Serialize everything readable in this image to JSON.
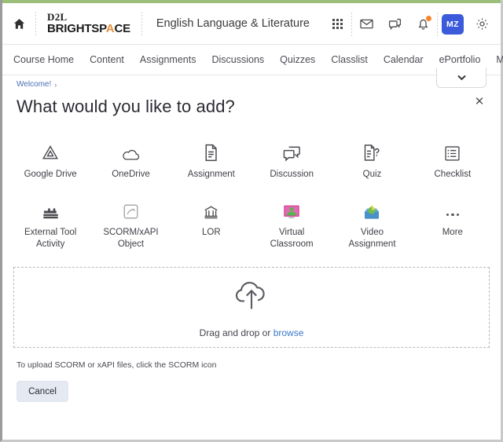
{
  "header": {
    "home_icon": "home-icon",
    "logo_top": "D2L",
    "logo_main_pre": "BRIGHTSP",
    "logo_accent": "A",
    "logo_main_post": "CE",
    "course_title": "English Language & Literature",
    "icons": [
      {
        "name": "waffle-menu-icon",
        "label": "Waffle Menu"
      },
      {
        "name": "email-icon",
        "label": "Email"
      },
      {
        "name": "chat-icon",
        "label": "Chat"
      },
      {
        "name": "notifications-bell-icon",
        "label": "Notifications",
        "badge": true
      },
      {
        "name": "gear-icon",
        "label": "Settings"
      }
    ],
    "avatar_initials": "MZ",
    "avatar_color": "#3b5bdb",
    "badge_color": "#f5862c",
    "accent_strip_color": "#9bbf7a"
  },
  "nav": {
    "items": [
      {
        "label": "Course Home"
      },
      {
        "label": "Content"
      },
      {
        "label": "Assignments"
      },
      {
        "label": "Discussions"
      },
      {
        "label": "Quizzes"
      },
      {
        "label": "Classlist"
      },
      {
        "label": "Calendar"
      },
      {
        "label": "ePortfolio"
      },
      {
        "label": "More"
      }
    ]
  },
  "panel": {
    "breadcrumb": "Welcome!",
    "breadcrumb_chevron": "›",
    "title": "What would you like to add?",
    "close_label": "✕",
    "dropdown_chevron": "chevron-down-icon"
  },
  "tiles": [
    {
      "label": "Google Drive",
      "icon": "google-drive-icon"
    },
    {
      "label": "OneDrive",
      "icon": "onedrive-icon"
    },
    {
      "label": "Assignment",
      "icon": "assignment-icon"
    },
    {
      "label": "Discussion",
      "icon": "discussion-icon"
    },
    {
      "label": "Quiz",
      "icon": "quiz-icon"
    },
    {
      "label": "Checklist",
      "icon": "checklist-icon"
    },
    {
      "label": "External Tool Activity",
      "icon": "external-tool-icon"
    },
    {
      "label": "SCORM/xAPI Object",
      "icon": "scorm-xapi-icon"
    },
    {
      "label": "LOR",
      "icon": "lor-icon"
    },
    {
      "label": "Virtual Classroom",
      "icon": "virtual-classroom-icon",
      "color": "#d94ba0"
    },
    {
      "label": "Video Assignment",
      "icon": "video-assignment-icon",
      "color": "#4a90c9"
    },
    {
      "label": "More",
      "icon": "more-dots-icon"
    }
  ],
  "dropzone": {
    "icon": "cloud-upload-icon",
    "text_prefix": "Drag and drop or ",
    "link_label": "browse",
    "link_color": "#3a78c9"
  },
  "footer": {
    "hint": "To upload SCORM or xAPI files, click the SCORM icon",
    "cancel_label": "Cancel"
  }
}
